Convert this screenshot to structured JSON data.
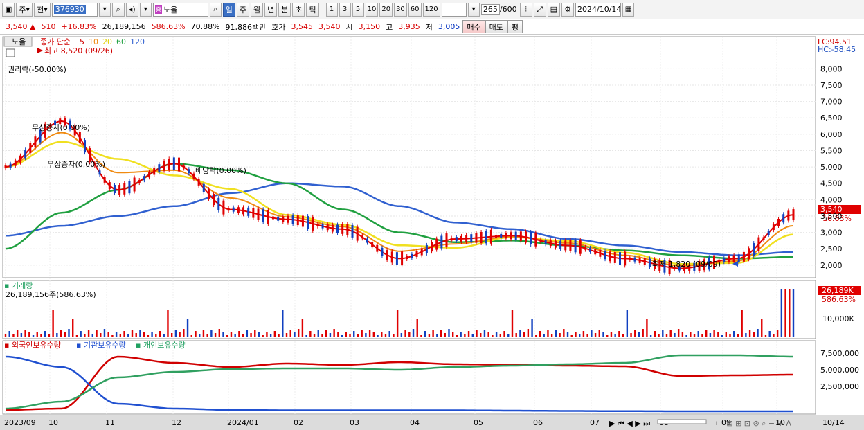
{
  "toolbar": {
    "type_label": "주",
    "prev_label": "전",
    "stock_code": "376930",
    "stock_name": "노을",
    "periods": [
      "일",
      "주",
      "월",
      "년",
      "분",
      "초",
      "틱"
    ],
    "selected_period": "일",
    "nums": [
      "1",
      "3",
      "5",
      "10",
      "20",
      "30",
      "60",
      "120"
    ],
    "count": "265",
    "count_max": "/600",
    "date": "2024/10/14",
    "icons": [
      "candle-icon",
      "period-icon",
      "save-icon",
      "settings-icon",
      "calendar-icon"
    ]
  },
  "quote": {
    "price": "3,540",
    "change": "510",
    "change_pct": "+16.83%",
    "volume": "26,189,156",
    "vol_pct": "586.63%",
    "ratio": "70.88%",
    "amount": "91,886백만",
    "hoga_label": "호가",
    "ask": "3,545",
    "bid": "3,540",
    "open_label": "시",
    "open": "3,150",
    "high_label": "고",
    "high": "3,935",
    "low_label": "저",
    "low": "3,005",
    "buy_label": "매수",
    "sell_label": "매도",
    "avg_label": "평"
  },
  "price_panel": {
    "stock_tab": "노을",
    "legend_title": "종가 단순",
    "ma_labels": [
      "5",
      "10",
      "20",
      "60",
      "120"
    ],
    "high_note": "최고 8,520 (09/26)",
    "low_note": "최저 1,820 (09/09)",
    "events": [
      "권리락(-50.00%)",
      "무상증자(0.00%)",
      "무상증자(0.00%)",
      "배당락(0.00%)"
    ],
    "lc": "LC:94.51",
    "hc": "HC:-58.45",
    "cur_price_tag": "3,540",
    "cur_pct_tag": "16.83%",
    "yaxis": [
      "8,000",
      "7,500",
      "7,000",
      "6,500",
      "6,000",
      "5,500",
      "5,000",
      "4,500",
      "4,000",
      "3,500",
      "3,000",
      "2,500",
      "2,000"
    ]
  },
  "volume_panel": {
    "title": "거래량",
    "value": "26,189,156주(586.63%)",
    "tag_val": "26,189K",
    "tag_pct": "586.63%",
    "yaxis": [
      "10,000K"
    ]
  },
  "holding_panel": {
    "titles": [
      "외국인보유수량",
      "기관보유수량",
      "개인보유수량"
    ],
    "yaxis": [
      "7,500,000",
      "5,000,000",
      "2,500,000"
    ]
  },
  "xaxis": [
    "2023/09",
    "10",
    "11",
    "12",
    "2024/01",
    "02",
    "03",
    "04",
    "05",
    "06",
    "07",
    "08",
    "09",
    "10",
    "10/14"
  ],
  "colors": {
    "up": "#e00000",
    "down": "#1040c0",
    "ma5": "#e00000",
    "ma10": "#f08a10",
    "ma20": "#f0e020",
    "ma60": "#20a040",
    "ma120": "#3060d0",
    "foreign": "#d00000",
    "inst": "#2050d0",
    "indiv": "#30a060"
  },
  "chart_data": {
    "type": "line",
    "x": [
      "2023/09",
      "10",
      "11",
      "12",
      "2024/01",
      "02",
      "03",
      "04",
      "05",
      "06",
      "07",
      "08",
      "09",
      "10",
      "10/14"
    ],
    "series": [
      {
        "name": "종가",
        "values": [
          5000,
          6400,
          4300,
          5100,
          3700,
          3400,
          3100,
          2200,
          2800,
          2900,
          2600,
          2200,
          1900,
          2200,
          3540
        ]
      },
      {
        "name": "120",
        "values": [
          2900,
          3200,
          3500,
          3800,
          4200,
          4500,
          4400,
          3800,
          3300,
          3100,
          2800,
          2600,
          2400,
          2300,
          2400
        ]
      },
      {
        "name": "60",
        "values": [
          2500,
          3600,
          4300,
          5100,
          4900,
          4500,
          3700,
          3000,
          2700,
          2750,
          2600,
          2450,
          2300,
          2200,
          2250
        ]
      },
      {
        "name": "외국인보유수량",
        "values": [
          300000,
          500000,
          8000000,
          7100000,
          6500000,
          7000000,
          6800000,
          7200000,
          6900000,
          6800000,
          6700000,
          6600000,
          5200000,
          5300000,
          5400000
        ]
      },
      {
        "name": "기관보유수량",
        "values": [
          8000000,
          6500000,
          1200000,
          500000,
          300000,
          250000,
          250000,
          250000,
          250000,
          200000,
          150000,
          120000,
          100000,
          100000,
          100000
        ]
      },
      {
        "name": "개인보유수량",
        "values": [
          500000,
          1500000,
          5000000,
          5800000,
          6200000,
          6300000,
          6300000,
          6100000,
          6500000,
          6700000,
          6900000,
          7100000,
          8200000,
          8200000,
          8000000
        ]
      }
    ],
    "price_ylim": [
      1700,
      8600
    ],
    "volume_pct_last": 586.63
  }
}
